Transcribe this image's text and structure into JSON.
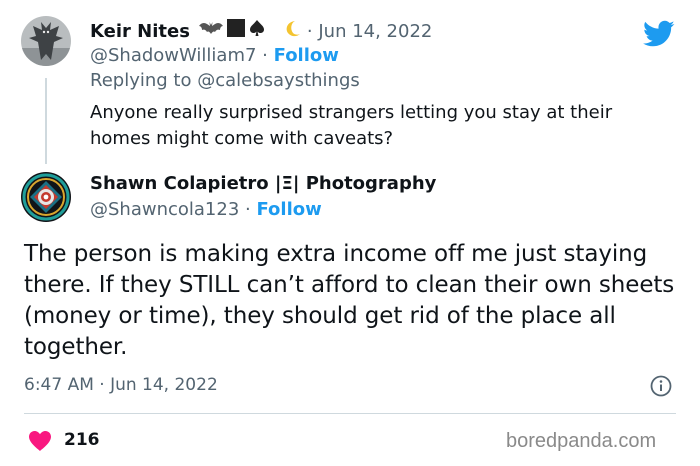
{
  "tweet_parent": {
    "display_name": "Keir Nites",
    "date": "· Jun 14, 2022",
    "handle": "@ShadowWilliam7",
    "separator": " · ",
    "follow_label": "Follow",
    "replying_prefix": "Replying to ",
    "replying_to": "@calebsaysthings",
    "text": "Anyone really surprised strangers letting you stay at their homes might come with caveats?"
  },
  "tweet_main": {
    "display_name": "Shawn Colapietro |Ξ| Photography",
    "handle": "@Shawncola123",
    "separator": " · ",
    "follow_label": "Follow",
    "text": "The person is making extra income off me just staying there. If they STILL can’t afford to clean their own sheets (money or time), they should get rid of the place all together.",
    "timestamp": "6:47 AM · Jun 14, 2022",
    "likes": "216"
  },
  "watermark": "boredpanda.com",
  "colors": {
    "twitter_blue": "#1d9bf0",
    "heart": "#f91880",
    "secondary_text": "#536471",
    "divider": "#cfd9de"
  },
  "icons": {
    "brand": "twitter-bird-icon",
    "info": "info-circle-icon",
    "like": "heart-icon",
    "emojis": [
      "bat-icon",
      "black-square-icon",
      "spade-icon",
      "crescent-moon-icon"
    ]
  }
}
